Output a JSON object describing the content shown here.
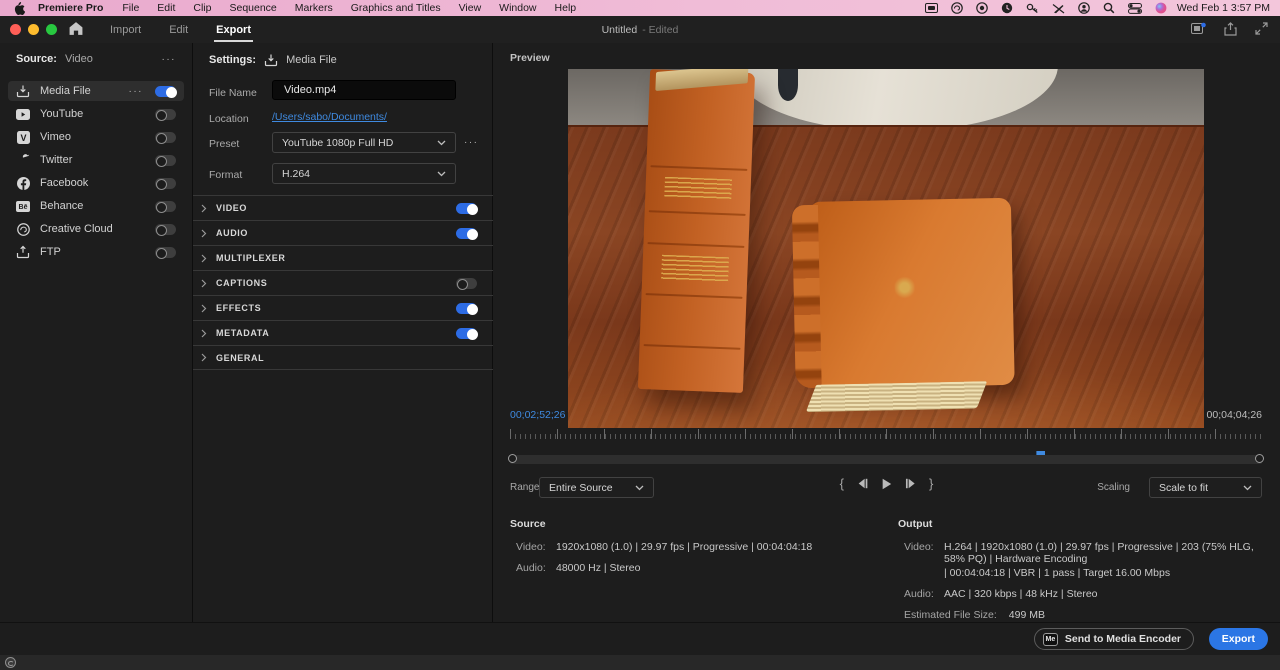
{
  "ui": {
    "ellipsis": "···"
  },
  "colors": {
    "accent_blue": "#2d6ce5",
    "link_blue": "#3f8ae0",
    "export_blue": "#2b76e5",
    "menubar_pink": "#f0bcd7"
  },
  "menu_bar": {
    "app_name": "Premiere Pro",
    "items": [
      "File",
      "Edit",
      "Clip",
      "Sequence",
      "Markers",
      "Graphics and Titles",
      "View",
      "Window",
      "Help"
    ],
    "status_icons": [
      "display-mirroring",
      "creative-cloud",
      "camera",
      "clock-app",
      "key",
      "stylus-slash",
      "account",
      "spotlight",
      "control-center",
      "siri"
    ],
    "clock": "Wed Feb 1  3:57 PM"
  },
  "title_bar": {
    "tabs": [
      {
        "label": "Import"
      },
      {
        "label": "Edit"
      },
      {
        "label": "Export"
      }
    ],
    "document_title": "Untitled",
    "document_state": "- Edited"
  },
  "sidebar": {
    "source_label": "Source:",
    "source_value": "Video",
    "destinations": [
      {
        "label": "Media File",
        "icon": "media-file-icon",
        "on": true
      },
      {
        "label": "YouTube",
        "icon": "youtube-icon",
        "on": false
      },
      {
        "label": "Vimeo",
        "icon": "vimeo-icon",
        "on": false
      },
      {
        "label": "Twitter",
        "icon": "twitter-icon",
        "on": false
      },
      {
        "label": "Facebook",
        "icon": "facebook-icon",
        "on": false
      },
      {
        "label": "Behance",
        "icon": "behance-icon",
        "on": false
      },
      {
        "label": "Creative Cloud",
        "icon": "creative-cloud-icon",
        "on": false
      },
      {
        "label": "FTP",
        "icon": "ftp-icon",
        "on": false
      }
    ]
  },
  "settings": {
    "header_label": "Settings:",
    "header_value": "Media File",
    "file_name_label": "File Name",
    "file_name_value": "Video.mp4",
    "location_label": "Location",
    "location_value": "/Users/sabo/Documents/",
    "preset_label": "Preset",
    "preset_value": "YouTube 1080p Full HD",
    "format_label": "Format",
    "format_value": "H.264",
    "sections": [
      {
        "label": "VIDEO",
        "toggle": "on"
      },
      {
        "label": "AUDIO",
        "toggle": "on"
      },
      {
        "label": "MULTIPLEXER",
        "toggle": "none"
      },
      {
        "label": "CAPTIONS",
        "toggle": "off"
      },
      {
        "label": "EFFECTS",
        "toggle": "on"
      },
      {
        "label": "METADATA",
        "toggle": "on"
      },
      {
        "label": "GENERAL",
        "toggle": "none"
      }
    ]
  },
  "preview": {
    "title": "Preview",
    "current_time": "00;02;52;26",
    "duration": "00;04;04;26",
    "playhead_percent": 70,
    "transport": {
      "mark_in": "{",
      "mark_out": "}"
    },
    "range_label": "Range",
    "range_value": "Entire Source",
    "scaling_label": "Scaling",
    "scaling_value": "Scale to fit"
  },
  "info": {
    "source": {
      "title": "Source",
      "video_label": "Video:",
      "video_value": "1920x1080 (1.0)  |  29.97 fps  |  Progressive  |  00:04:04:18",
      "audio_label": "Audio:",
      "audio_value": "48000 Hz  |  Stereo"
    },
    "output": {
      "title": "Output",
      "video_label": "Video:",
      "video_line1": "H.264  |  1920x1080 (1.0)  |  29.97 fps  |  Progressive  |  203 (75% HLG, 58% PQ)  |  Hardware Encoding",
      "video_line2": "|  00:04:04:18  |  VBR  |  1 pass  |  Target 16.00 Mbps",
      "audio_label": "Audio:",
      "audio_value": "AAC  |  320 kbps  |  48 kHz  |  Stereo",
      "size_label": "Estimated File Size:",
      "size_value": "499 MB"
    }
  },
  "footer": {
    "send_badge": "Me",
    "send_button": "Send to Media Encoder",
    "export_button": "Export"
  }
}
